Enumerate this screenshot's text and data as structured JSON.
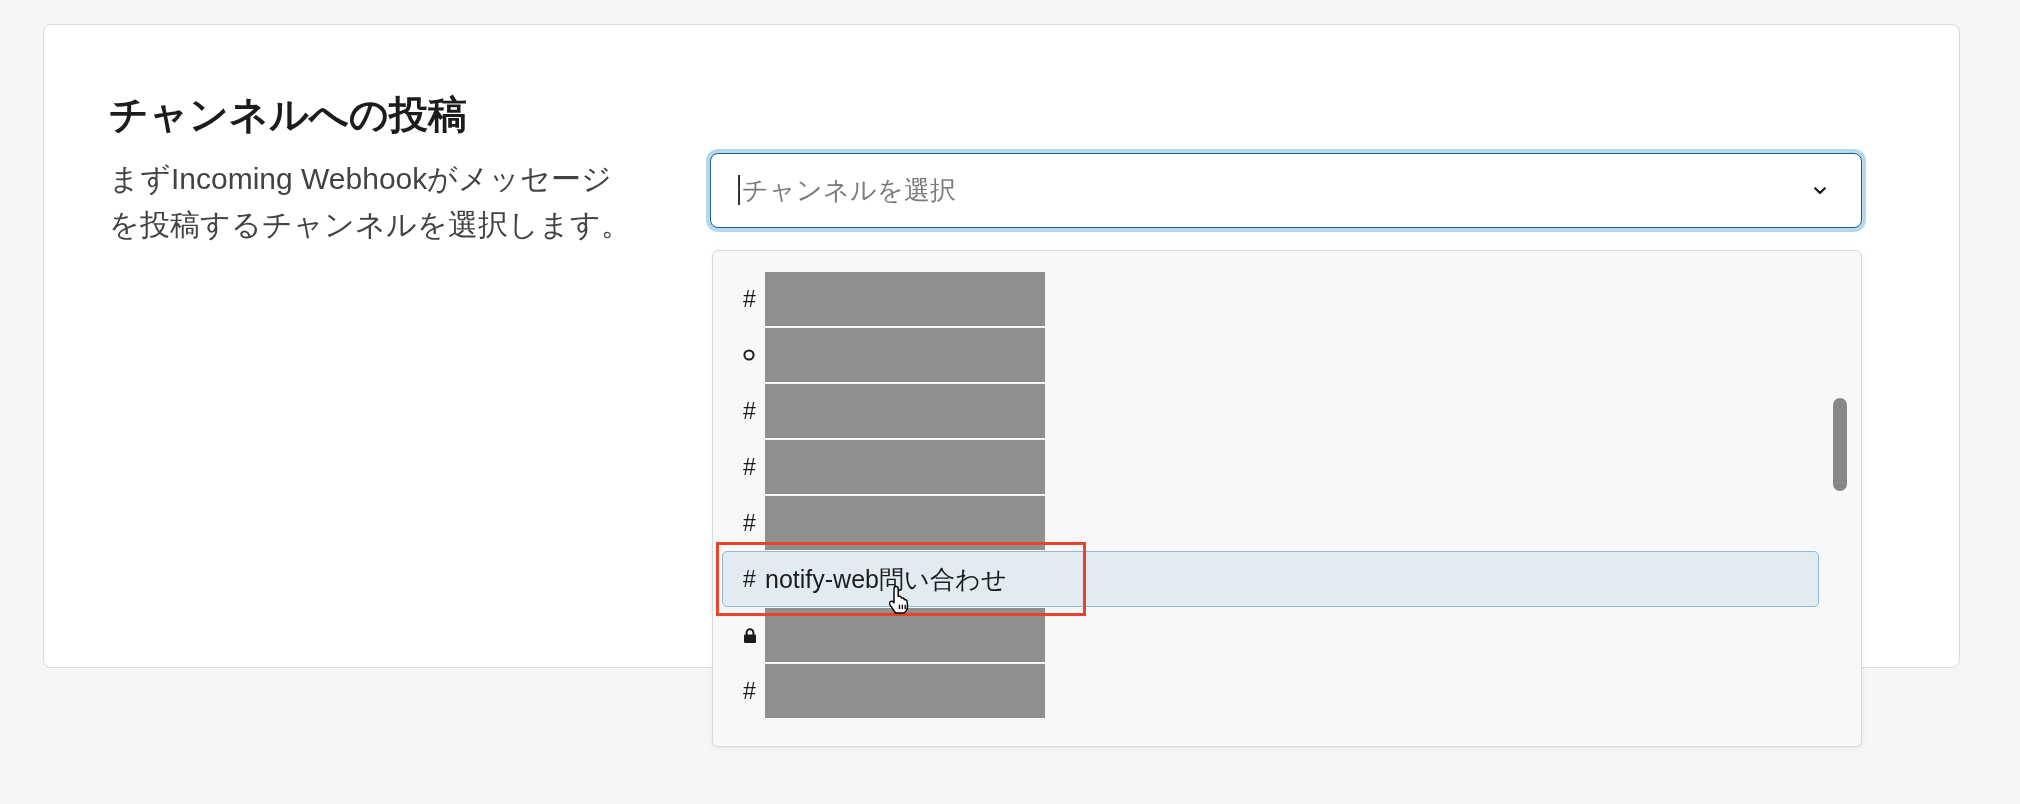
{
  "section": {
    "title": "チャンネルへの投稿",
    "description": "まずIncoming Webhookがメッセージを投稿するチャンネルを選択します。"
  },
  "channel_select": {
    "placeholder": "チャンネルを選択",
    "expanded": true
  },
  "options": [
    {
      "kind": "hash",
      "symbol": "#",
      "redacted": true,
      "selected": false
    },
    {
      "kind": "ring",
      "redacted": true,
      "selected": false
    },
    {
      "kind": "hash",
      "symbol": "#",
      "redacted": true,
      "selected": false
    },
    {
      "kind": "hash",
      "symbol": "#",
      "redacted": true,
      "selected": false
    },
    {
      "kind": "hash",
      "symbol": "#",
      "redacted": true,
      "selected": false
    },
    {
      "kind": "hash",
      "symbol": "#",
      "name": "notify-web問い合わせ",
      "redacted": false,
      "selected": true
    },
    {
      "kind": "lock",
      "redacted": true,
      "selected": false
    },
    {
      "kind": "hash",
      "symbol": "#",
      "redacted": true,
      "selected": false
    }
  ]
}
